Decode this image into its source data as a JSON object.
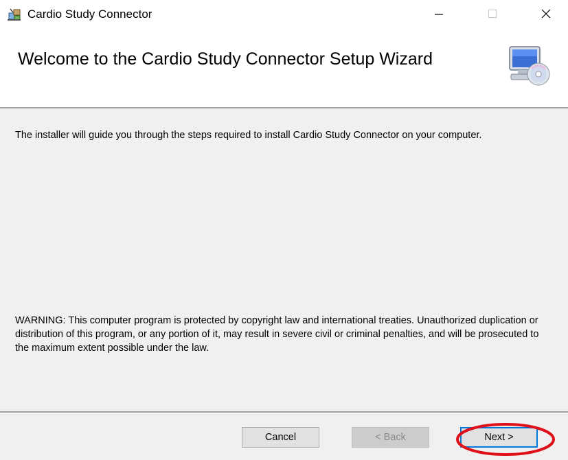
{
  "window": {
    "title": "Cardio Study Connector",
    "icon": "installer-icon",
    "controls": {
      "minimize": "minimize-icon",
      "maximize": "maximize-icon",
      "close": "close-icon"
    }
  },
  "banner": {
    "title": "Welcome to the Cardio Study Connector Setup Wizard",
    "icon": "computer-cd-icon"
  },
  "content": {
    "intro": "The installer will guide you through the steps required to install Cardio Study Connector on your computer.",
    "warning": "WARNING: This computer program is protected by copyright law and international treaties. Unauthorized duplication or distribution of this program, or any portion of it, may result in severe civil or criminal penalties, and will be prosecuted to the maximum extent possible under the law."
  },
  "buttons": {
    "cancel": "Cancel",
    "back": "< Back",
    "next": "Next >"
  },
  "annotation": {
    "color": "#e0101a",
    "shape": "ellipse"
  },
  "colors": {
    "background": "#f0f0f0",
    "focus": "#0078d7"
  }
}
